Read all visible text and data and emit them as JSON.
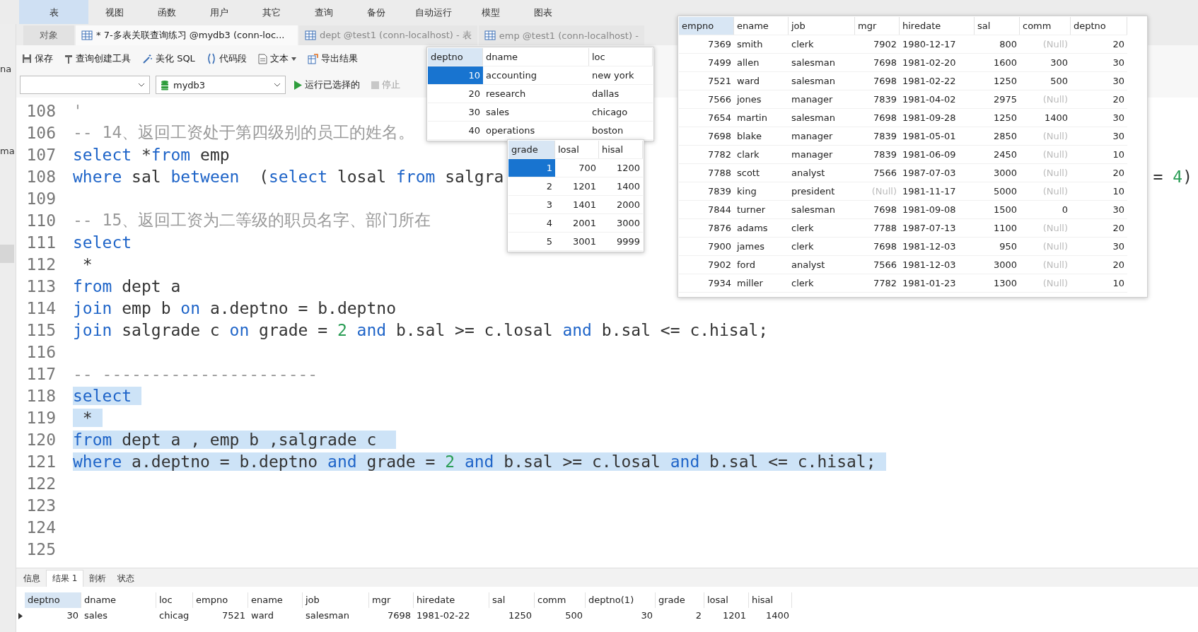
{
  "menu": [
    {
      "label": "表",
      "selected": true
    },
    {
      "label": "视图",
      "selected": false
    },
    {
      "label": "函数",
      "selected": false
    },
    {
      "label": "用户",
      "selected": false
    },
    {
      "label": "其它",
      "selected": false
    },
    {
      "label": "查询",
      "selected": false
    },
    {
      "label": "备份",
      "selected": false
    },
    {
      "label": "自动运行",
      "selected": false
    },
    {
      "label": "模型",
      "selected": false
    },
    {
      "label": "图表",
      "selected": false
    }
  ],
  "side_labels": [
    "na",
    "ma"
  ],
  "object_tab": "对象",
  "tabs": [
    {
      "label": "* 7-多表关联查询练习 @mydb3 (conn-loc...",
      "selected": true
    },
    {
      "label": "dept @test1 (conn-localhost) - 表",
      "selected": false
    },
    {
      "label": "emp @test1 (conn-localhost) -",
      "selected": false
    }
  ],
  "toolbar": [
    {
      "kind": "save",
      "label": "保存"
    },
    {
      "kind": "builder",
      "label": "查询创建工具"
    },
    {
      "kind": "beautify",
      "label": "美化 SQL"
    },
    {
      "kind": "snippet",
      "label": "代码段"
    },
    {
      "kind": "text",
      "label": "文本"
    },
    {
      "kind": "export",
      "label": "导出结果"
    }
  ],
  "database_select": {
    "value": "mydb3"
  },
  "run_button": {
    "label": "运行已选择的"
  },
  "stop_button": {
    "label": "停止",
    "disabled": true
  },
  "code_lines": [
    {
      "number": "108",
      "selected": false,
      "tokens": [
        {
          "kind": "comment",
          "text": "'"
        }
      ]
    },
    {
      "number": "106",
      "selected": false,
      "tokens": [
        {
          "kind": "comment",
          "text": "-- 14、返回工资处于第四级别的员工的姓名。"
        }
      ]
    },
    {
      "number": "107",
      "selected": false,
      "tokens": [
        {
          "kind": "keyword",
          "text": "select"
        },
        {
          "kind": "plain",
          "text": " *"
        },
        {
          "kind": "keyword",
          "text": "from"
        },
        {
          "kind": "plain",
          "text": " emp"
        }
      ]
    },
    {
      "number": "108",
      "selected": false,
      "tokens": [
        {
          "kind": "keyword",
          "text": "where"
        },
        {
          "kind": "plain",
          "text": " sal "
        },
        {
          "kind": "keyword",
          "text": "between"
        },
        {
          "kind": "plain",
          "text": "  ("
        },
        {
          "kind": "keyword",
          "text": "select"
        },
        {
          "kind": "plain",
          "text": " losal "
        },
        {
          "kind": "keyword",
          "text": "from"
        },
        {
          "kind": "plain",
          "text": " salgra"
        }
      ],
      "tail": [
        {
          "kind": "plain",
          "text": "= "
        },
        {
          "kind": "number",
          "text": "4"
        },
        {
          "kind": "plain",
          "text": ")"
        }
      ]
    },
    {
      "number": "109",
      "selected": false
    },
    {
      "number": "110",
      "selected": false,
      "tokens": [
        {
          "kind": "comment",
          "text": "-- 15、返回工资为二等级的职员名字、部门所在"
        }
      ]
    },
    {
      "number": "111",
      "selected": false,
      "tokens": [
        {
          "kind": "keyword",
          "text": "select"
        }
      ]
    },
    {
      "number": "112",
      "selected": false,
      "tokens": [
        {
          "kind": "plain",
          "text": " *"
        }
      ]
    },
    {
      "number": "113",
      "selected": false,
      "tokens": [
        {
          "kind": "keyword",
          "text": "from"
        },
        {
          "kind": "plain",
          "text": " dept a"
        }
      ]
    },
    {
      "number": "114",
      "selected": false,
      "tokens": [
        {
          "kind": "keyword",
          "text": "join"
        },
        {
          "kind": "plain",
          "text": " emp b "
        },
        {
          "kind": "keyword",
          "text": "on"
        },
        {
          "kind": "plain",
          "text": " a.deptno = b.deptno"
        }
      ]
    },
    {
      "number": "115",
      "selected": false,
      "tokens": [
        {
          "kind": "keyword",
          "text": "join"
        },
        {
          "kind": "plain",
          "text": " salgrade c "
        },
        {
          "kind": "keyword",
          "text": "on"
        },
        {
          "kind": "plain",
          "text": " grade = "
        },
        {
          "kind": "number",
          "text": "2"
        },
        {
          "kind": "keyword",
          "text": " and"
        },
        {
          "kind": "plain",
          "text": " b.sal >= c.losal "
        },
        {
          "kind": "keyword",
          "text": "and"
        },
        {
          "kind": "plain",
          "text": " b.sal <= c.hisal;"
        }
      ]
    },
    {
      "number": "116",
      "selected": false
    },
    {
      "number": "117",
      "selected": false,
      "tokens": [
        {
          "kind": "comment",
          "text": "-- ----------------------"
        }
      ]
    },
    {
      "number": "118",
      "selected": true,
      "tokens": [
        {
          "kind": "keyword",
          "text": "select"
        }
      ]
    },
    {
      "number": "119",
      "selected": true,
      "tokens": [
        {
          "kind": "plain",
          "text": " *"
        }
      ]
    },
    {
      "number": "120",
      "selected": true,
      "tokens": [
        {
          "kind": "keyword",
          "text": "from"
        },
        {
          "kind": "plain",
          "text": " dept a , emp b ,salgrade c "
        }
      ]
    },
    {
      "number": "121",
      "selected": true,
      "tokens": [
        {
          "kind": "keyword",
          "text": "where"
        },
        {
          "kind": "plain",
          "text": " a.deptno = b.deptno "
        },
        {
          "kind": "keyword",
          "text": "and"
        },
        {
          "kind": "plain",
          "text": " grade = "
        },
        {
          "kind": "number",
          "text": "2"
        },
        {
          "kind": "keyword",
          "text": " and"
        },
        {
          "kind": "plain",
          "text": " b.sal >= c.losal "
        },
        {
          "kind": "keyword",
          "text": "and"
        },
        {
          "kind": "plain",
          "text": " b.sal <= c.hisal;"
        }
      ]
    },
    {
      "number": "122",
      "selected": false
    },
    {
      "number": "123",
      "selected": false
    },
    {
      "number": "124",
      "selected": false
    },
    {
      "number": "125",
      "selected": false
    }
  ],
  "dept_popup": {
    "columns": [
      {
        "label": "deptno",
        "selected": true
      },
      {
        "label": "dname",
        "selected": false
      },
      {
        "label": "loc",
        "selected": false
      }
    ],
    "rows": [
      {
        "selected": true,
        "cells": [
          "10",
          "accounting",
          "new york"
        ]
      },
      {
        "selected": false,
        "cells": [
          "20",
          "research",
          "dallas"
        ]
      },
      {
        "selected": false,
        "cells": [
          "30",
          "sales",
          "chicago"
        ]
      },
      {
        "selected": false,
        "cells": [
          "40",
          "operations",
          "boston"
        ]
      }
    ]
  },
  "salgrade_popup": {
    "columns": [
      {
        "label": "grade",
        "selected": true
      },
      {
        "label": "losal",
        "selected": false
      },
      {
        "label": "hisal",
        "selected": false
      }
    ],
    "rows": [
      {
        "selected": true,
        "cells": [
          "1",
          "700",
          "1200"
        ]
      },
      {
        "selected": false,
        "cells": [
          "2",
          "1201",
          "1400"
        ]
      },
      {
        "selected": false,
        "cells": [
          "3",
          "1401",
          "2000"
        ]
      },
      {
        "selected": false,
        "cells": [
          "4",
          "2001",
          "3000"
        ]
      },
      {
        "selected": false,
        "cells": [
          "5",
          "3001",
          "9999"
        ]
      }
    ]
  },
  "emp_popup": {
    "columns": [
      {
        "label": "empno",
        "selected": true
      },
      {
        "label": "ename",
        "selected": false
      },
      {
        "label": "job",
        "selected": false
      },
      {
        "label": "mgr",
        "selected": false
      },
      {
        "label": "hiredate",
        "selected": false
      },
      {
        "label": "sal",
        "selected": false
      },
      {
        "label": "comm",
        "selected": false
      },
      {
        "label": "deptno",
        "selected": false
      }
    ],
    "rows": [
      [
        {
          "text": "7369",
          "null": false
        },
        {
          "text": "smith",
          "null": false
        },
        {
          "text": "clerk",
          "null": false
        },
        {
          "text": "7902",
          "null": false
        },
        {
          "text": "1980-12-17",
          "null": false
        },
        {
          "text": "800",
          "null": false
        },
        {
          "text": "(Null)",
          "null": true
        },
        {
          "text": "20",
          "null": false
        }
      ],
      [
        {
          "text": "7499",
          "null": false
        },
        {
          "text": "allen",
          "null": false
        },
        {
          "text": "salesman",
          "null": false
        },
        {
          "text": "7698",
          "null": false
        },
        {
          "text": "1981-02-20",
          "null": false
        },
        {
          "text": "1600",
          "null": false
        },
        {
          "text": "300",
          "null": false
        },
        {
          "text": "30",
          "null": false
        }
      ],
      [
        {
          "text": "7521",
          "null": false
        },
        {
          "text": "ward",
          "null": false
        },
        {
          "text": "salesman",
          "null": false
        },
        {
          "text": "7698",
          "null": false
        },
        {
          "text": "1981-02-22",
          "null": false
        },
        {
          "text": "1250",
          "null": false
        },
        {
          "text": "500",
          "null": false
        },
        {
          "text": "30",
          "null": false
        }
      ],
      [
        {
          "text": "7566",
          "null": false
        },
        {
          "text": "jones",
          "null": false
        },
        {
          "text": "manager",
          "null": false
        },
        {
          "text": "7839",
          "null": false
        },
        {
          "text": "1981-04-02",
          "null": false
        },
        {
          "text": "2975",
          "null": false
        },
        {
          "text": "(Null)",
          "null": true
        },
        {
          "text": "20",
          "null": false
        }
      ],
      [
        {
          "text": "7654",
          "null": false
        },
        {
          "text": "martin",
          "null": false
        },
        {
          "text": "salesman",
          "null": false
        },
        {
          "text": "7698",
          "null": false
        },
        {
          "text": "1981-09-28",
          "null": false
        },
        {
          "text": "1250",
          "null": false
        },
        {
          "text": "1400",
          "null": false
        },
        {
          "text": "30",
          "null": false
        }
      ],
      [
        {
          "text": "7698",
          "null": false
        },
        {
          "text": "blake",
          "null": false
        },
        {
          "text": "manager",
          "null": false
        },
        {
          "text": "7839",
          "null": false
        },
        {
          "text": "1981-05-01",
          "null": false
        },
        {
          "text": "2850",
          "null": false
        },
        {
          "text": "(Null)",
          "null": true
        },
        {
          "text": "30",
          "null": false
        }
      ],
      [
        {
          "text": "7782",
          "null": false
        },
        {
          "text": "clark",
          "null": false
        },
        {
          "text": "manager",
          "null": false
        },
        {
          "text": "7839",
          "null": false
        },
        {
          "text": "1981-06-09",
          "null": false
        },
        {
          "text": "2450",
          "null": false
        },
        {
          "text": "(Null)",
          "null": true
        },
        {
          "text": "10",
          "null": false
        }
      ],
      [
        {
          "text": "7788",
          "null": false
        },
        {
          "text": "scott",
          "null": false
        },
        {
          "text": "analyst",
          "null": false
        },
        {
          "text": "7566",
          "null": false
        },
        {
          "text": "1987-07-03",
          "null": false
        },
        {
          "text": "3000",
          "null": false
        },
        {
          "text": "(Null)",
          "null": true
        },
        {
          "text": "20",
          "null": false
        }
      ],
      [
        {
          "text": "7839",
          "null": false
        },
        {
          "text": "king",
          "null": false
        },
        {
          "text": "president",
          "null": false
        },
        {
          "text": "(Null)",
          "null": true
        },
        {
          "text": "1981-11-17",
          "null": false
        },
        {
          "text": "5000",
          "null": false
        },
        {
          "text": "(Null)",
          "null": true
        },
        {
          "text": "10",
          "null": false
        }
      ],
      [
        {
          "text": "7844",
          "null": false
        },
        {
          "text": "turner",
          "null": false
        },
        {
          "text": "salesman",
          "null": false
        },
        {
          "text": "7698",
          "null": false
        },
        {
          "text": "1981-09-08",
          "null": false
        },
        {
          "text": "1500",
          "null": false
        },
        {
          "text": "0",
          "null": false
        },
        {
          "text": "30",
          "null": false
        }
      ],
      [
        {
          "text": "7876",
          "null": false
        },
        {
          "text": "adams",
          "null": false
        },
        {
          "text": "clerk",
          "null": false
        },
        {
          "text": "7788",
          "null": false
        },
        {
          "text": "1987-07-13",
          "null": false
        },
        {
          "text": "1100",
          "null": false
        },
        {
          "text": "(Null)",
          "null": true
        },
        {
          "text": "20",
          "null": false
        }
      ],
      [
        {
          "text": "7900",
          "null": false
        },
        {
          "text": "james",
          "null": false
        },
        {
          "text": "clerk",
          "null": false
        },
        {
          "text": "7698",
          "null": false
        },
        {
          "text": "1981-12-03",
          "null": false
        },
        {
          "text": "950",
          "null": false
        },
        {
          "text": "(Null)",
          "null": true
        },
        {
          "text": "30",
          "null": false
        }
      ],
      [
        {
          "text": "7902",
          "null": false
        },
        {
          "text": "ford",
          "null": false
        },
        {
          "text": "analyst",
          "null": false
        },
        {
          "text": "7566",
          "null": false
        },
        {
          "text": "1981-12-03",
          "null": false
        },
        {
          "text": "3000",
          "null": false
        },
        {
          "text": "(Null)",
          "null": true
        },
        {
          "text": "20",
          "null": false
        }
      ],
      [
        {
          "text": "7934",
          "null": false
        },
        {
          "text": "miller",
          "null": false
        },
        {
          "text": "clerk",
          "null": false
        },
        {
          "text": "7782",
          "null": false
        },
        {
          "text": "1981-01-23",
          "null": false
        },
        {
          "text": "1300",
          "null": false
        },
        {
          "text": "(Null)",
          "null": true
        },
        {
          "text": "10",
          "null": false
        }
      ]
    ]
  },
  "result_tabs": [
    {
      "label": "信息",
      "selected": false
    },
    {
      "label": "结果 1",
      "selected": true
    },
    {
      "label": "剖析",
      "selected": false
    },
    {
      "label": "状态",
      "selected": false
    }
  ],
  "result_table": {
    "columns": [
      {
        "label": "deptno",
        "selected": true
      },
      {
        "label": "dname",
        "selected": false
      },
      {
        "label": "loc",
        "selected": false
      },
      {
        "label": "empno",
        "selected": false
      },
      {
        "label": "ename",
        "selected": false
      },
      {
        "label": "job",
        "selected": false
      },
      {
        "label": "mgr",
        "selected": false
      },
      {
        "label": "hiredate",
        "selected": false
      },
      {
        "label": "sal",
        "selected": false
      },
      {
        "label": "comm",
        "selected": false
      },
      {
        "label": "deptno(1)",
        "selected": false
      },
      {
        "label": "grade",
        "selected": false
      },
      {
        "label": "losal",
        "selected": false
      },
      {
        "label": "hisal",
        "selected": false
      }
    ],
    "rows": [
      [
        "30",
        "sales",
        "chicag",
        "7521",
        "ward",
        "salesman",
        "7698",
        "1981-02-22",
        "1250",
        "500",
        "30",
        "2",
        "1201",
        "1400"
      ]
    ]
  }
}
